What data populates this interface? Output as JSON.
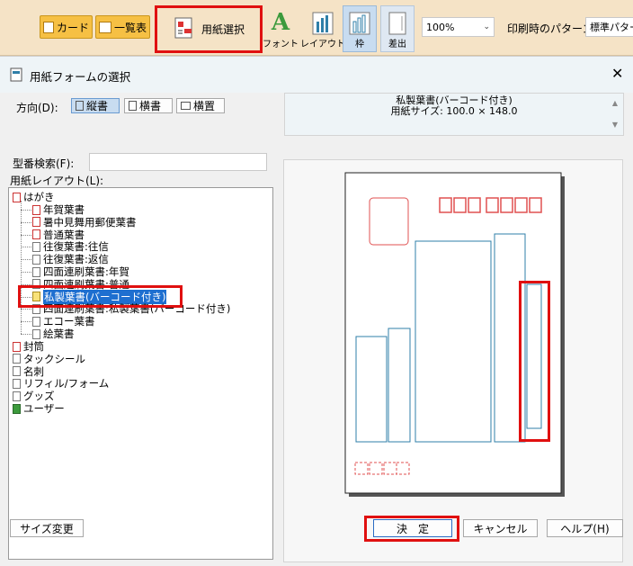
{
  "toolbar": {
    "card_label": "カード",
    "list_label": "一覧表",
    "paper_select_label": "用紙選択",
    "font_label": "フォント",
    "layout_label": "レイアウト",
    "frame_label": "枠",
    "insert_label": "差出",
    "zoom_value": "100%",
    "print_pattern_label": "印刷時のパターン",
    "print_pattern_value": "標準パター"
  },
  "dialog": {
    "title": "用紙フォームの選択",
    "direction_label": "方向(D):",
    "direction_options": [
      "縦書",
      "横書",
      "横置"
    ],
    "direction_selected": "縦書",
    "search_label": "型番検索(F):",
    "search_value": "",
    "layout_label": "用紙レイアウト(L):",
    "info": {
      "name": "私製葉書(バーコード付き)",
      "size": "用紙サイズ: 100.0 × 148.0"
    },
    "tree": {
      "root": "はがき",
      "children": [
        "年賀葉書",
        "暑中見舞用郵便葉書",
        "普通葉書",
        "往復葉書:往信",
        "往復葉書:返信",
        "四面連刷葉書:年賀",
        "四面連刷葉書:普通",
        "私製葉書(バーコード付き)",
        "四面連刷葉書:私製葉書(バーコード付き)",
        "エコー葉書",
        "絵葉書"
      ],
      "selected": "私製葉書(バーコード付き)",
      "others": [
        "封筒",
        "タックシール",
        "名刺",
        "リフィル/フォーム",
        "グッズ",
        "ユーザー"
      ]
    },
    "buttons": {
      "resize": "サイズ変更",
      "ok": "決　定",
      "cancel": "キャンセル",
      "help": "ヘルプ(H)"
    }
  },
  "colors": {
    "toolbar_bg": "#f5e3c6",
    "accent_yellow": "#f6c044",
    "highlight_red": "#e01010",
    "preview_blue": "#2f7fa8",
    "selection_blue": "#1e6fd0"
  }
}
